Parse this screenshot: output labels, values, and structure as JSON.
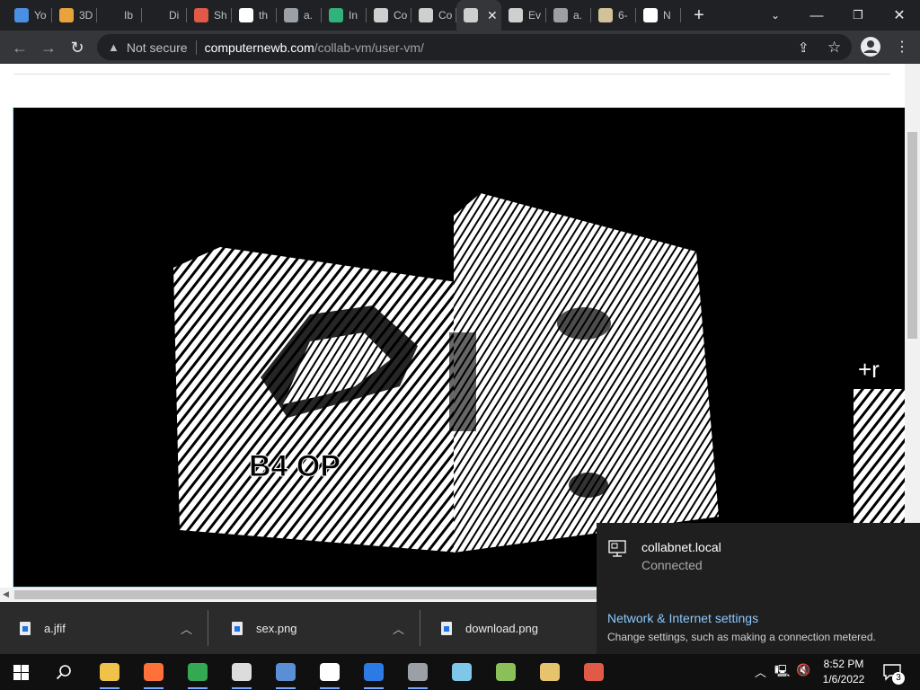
{
  "tabs": [
    {
      "label": "Yo",
      "favicon": "download-icon",
      "color": "#4a90e2"
    },
    {
      "label": "3D",
      "favicon": "colorful-icon",
      "color": "#e8a33d"
    },
    {
      "label": "Ib",
      "favicon": "blank-icon",
      "color": "#202124"
    },
    {
      "label": "Di",
      "favicon": "blank-icon",
      "color": "#202124"
    },
    {
      "label": "Sh",
      "favicon": "paint-icon",
      "color": "#e05a47"
    },
    {
      "label": "th",
      "favicon": "google-icon",
      "color": "#ffffff"
    },
    {
      "label": "a.",
      "favicon": "globe-icon",
      "color": "#9aa0a6"
    },
    {
      "label": "In",
      "favicon": "translate-icon",
      "color": "#2fb37a"
    },
    {
      "label": "Co",
      "favicon": "collabvm-icon",
      "color": "#cfcfcf"
    },
    {
      "label": "Co",
      "favicon": "collabvm-icon",
      "color": "#cfcfcf"
    },
    {
      "label": "",
      "favicon": "collabvm-icon",
      "color": "#cfcfcf",
      "active": true
    },
    {
      "label": "Ev",
      "favicon": "everything-icon",
      "color": "#cfcfcf"
    },
    {
      "label": "a.",
      "favicon": "globe-icon",
      "color": "#9aa0a6"
    },
    {
      "label": "6-",
      "favicon": "archive-icon",
      "color": "#d2c29a"
    },
    {
      "label": "N",
      "favicon": "chrome-icon",
      "color": "#ffffff"
    }
  ],
  "address": {
    "security_label": "Not secure",
    "host": "computernewb.com",
    "path": "/collab-vm/user-vm/"
  },
  "downloads": [
    {
      "filename": "a.jfif"
    },
    {
      "filename": "sex.png"
    },
    {
      "filename": "download.png"
    }
  ],
  "network": {
    "name": "collabnet.local",
    "status": "Connected",
    "settings_link": "Network & Internet settings",
    "settings_desc": "Change settings, such as making a connection metered."
  },
  "taskbar": {
    "time": "8:52 PM",
    "date": "1/6/2022",
    "notification_count": "3",
    "apps": [
      "file-explorer-icon",
      "firefox-icon",
      "chrome-icon",
      "obs-icon",
      "qbittorrent-icon",
      "photos-icon",
      "video-icon",
      "terminal-icon",
      "notepad-icon",
      "plant-icon",
      "paint-icon",
      "paint3d-icon"
    ]
  },
  "vm_screen": {
    "text_fragment": "B4 OP",
    "side_text": "+r"
  }
}
